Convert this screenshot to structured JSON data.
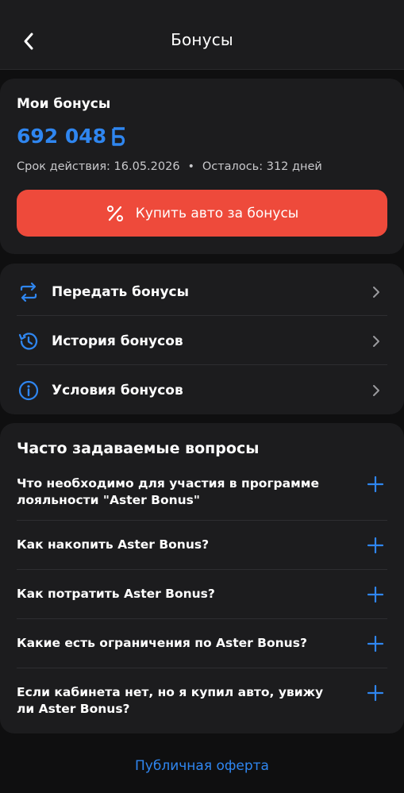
{
  "header": {
    "title": "Бонусы"
  },
  "bonus": {
    "title": "Мои бонусы",
    "amount": "692 048",
    "expiry_label": "Срок действия: 16.05.2026",
    "separator": "•",
    "remaining_label": "Осталось: 312 дней",
    "buy_button_label": "Купить авто за бонусы"
  },
  "menu": {
    "items": [
      {
        "label": "Передать бонусы",
        "icon": "transfer-icon"
      },
      {
        "label": "История бонусов",
        "icon": "history-icon"
      },
      {
        "label": "Условия бонусов",
        "icon": "info-icon"
      }
    ]
  },
  "faq": {
    "title": "Часто задаваемые вопросы",
    "questions": [
      "Что необходимо для участия в программе лояльности \"Aster Bonus\"",
      "Как накопить Aster Bonus?",
      "Как потратить Aster Bonus?",
      "Какие есть ограничения по Aster Bonus?",
      "Если кабинета нет, но я купил авто, увижу ли Aster Bonus?"
    ]
  },
  "footer": {
    "offer_link": "Публичная оферта"
  },
  "colors": {
    "accent": "#2f86f0",
    "primary_button": "#ee4a3b",
    "card": "#1c1c1e",
    "background": "#0f0f10"
  }
}
